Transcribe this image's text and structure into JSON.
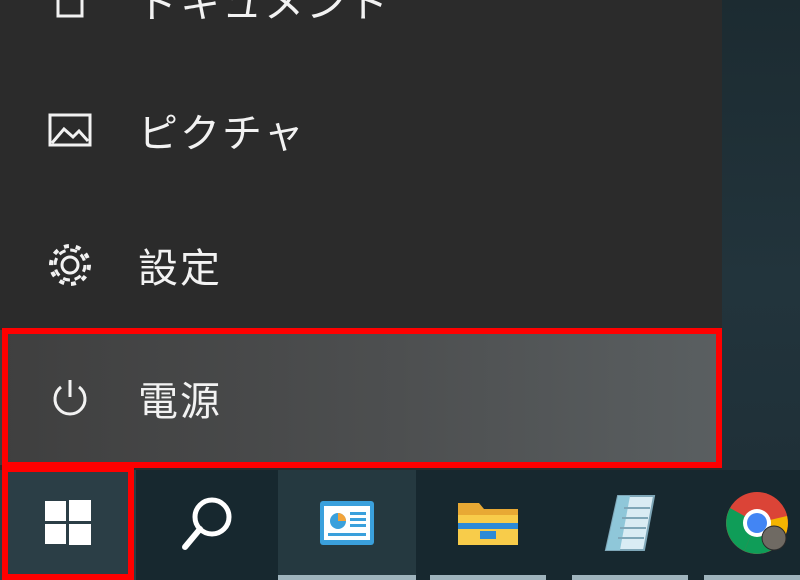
{
  "start_menu": {
    "items": [
      {
        "name": "documents",
        "label": "ドキュメント",
        "icon": "document-icon"
      },
      {
        "name": "pictures",
        "label": "ピクチャ",
        "icon": "picture-icon"
      },
      {
        "name": "settings",
        "label": "設定",
        "icon": "gear-icon"
      },
      {
        "name": "power",
        "label": "電源",
        "icon": "power-icon"
      }
    ]
  },
  "taskbar": {
    "buttons": [
      {
        "name": "start",
        "icon": "windows-logo-icon"
      },
      {
        "name": "search",
        "icon": "search-icon"
      },
      {
        "name": "app",
        "icon": "app-window-icon"
      },
      {
        "name": "file-explorer",
        "icon": "folder-icon"
      },
      {
        "name": "notepad",
        "icon": "notepad-icon"
      },
      {
        "name": "chrome",
        "icon": "chrome-icon"
      }
    ]
  },
  "colors": {
    "highlight": "#ff0000",
    "menu_background": "#2b2b2b",
    "taskbar_background": "#17282f"
  }
}
